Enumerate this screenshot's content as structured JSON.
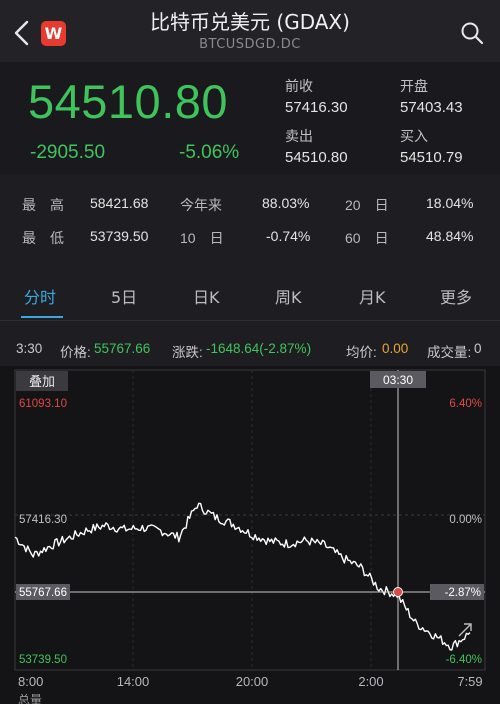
{
  "header": {
    "title": "比特币兑美元 (GDAX)",
    "subtitle": "BTCUSDGD.DC",
    "logo_text": "W"
  },
  "price": {
    "last": "54510.80",
    "change": "-2905.50",
    "change_pct": "-5.06%",
    "prev_close_label": "前收",
    "prev_close": "57416.30",
    "open_label": "开盘",
    "open": "57403.43",
    "bid_label": "卖出",
    "bid": "54510.80",
    "ask_label": "买入",
    "ask": "54510.79"
  },
  "stats": {
    "high_label": "最　高",
    "high": "58421.68",
    "low_label": "最　低",
    "low": "53739.50",
    "ytd_label": "今年来",
    "ytd": "88.03%",
    "d10_label": "10　日",
    "d10": "-0.74%",
    "d20_label": "20　日",
    "d20": "18.04%",
    "d60_label": "60　日",
    "d60": "48.84%"
  },
  "tabs": [
    "分时",
    "5日",
    "日K",
    "周K",
    "月K",
    "更多"
  ],
  "quote": {
    "time": "3:30",
    "price_label": "价格:",
    "price": "55767.66",
    "change_label": "涨跌:",
    "change": "-1648.64(-2.87%)",
    "avg_label": "均价:",
    "avg": "0.00",
    "volume_label": "成交量:",
    "volume": "0"
  },
  "chart": {
    "overlay_label": "叠加",
    "cursor_time": "03:30",
    "y_high": "61093.10",
    "y_mid": "57416.30",
    "y_low": "53739.50",
    "pct_high": "6.40%",
    "pct_mid": "0.00%",
    "pct_low": "-6.40%",
    "cursor_price": "55767.66",
    "cursor_pct": "-2.87%",
    "x_labels": [
      "8:00",
      "14:00",
      "20:00",
      "2:00",
      "7:59"
    ],
    "bottom_label": "总量",
    "colors": {
      "line": "#ffffff",
      "crosshair": "#c8c8c8",
      "up": "#e04848",
      "down": "#3fc35b",
      "marker": "#e04848"
    }
  },
  "chart_data": {
    "type": "line",
    "title": "",
    "xlabel": "",
    "ylabel": "",
    "ylim": [
      53739.5,
      61093.1
    ],
    "x": [
      "8:00",
      "9:00",
      "10:00",
      "11:00",
      "12:00",
      "13:00",
      "14:00",
      "15:00",
      "16:00",
      "17:00",
      "18:00",
      "19:00",
      "20:00",
      "21:00",
      "22:00",
      "23:00",
      "0:00",
      "1:00",
      "2:00",
      "3:00",
      "3:30",
      "4:00",
      "5:00",
      "6:00",
      "7:00",
      "7:59"
    ],
    "series": [
      {
        "values": [
          57216,
          56710,
          56980,
          57200,
          57420,
          57550,
          57430,
          57480,
          57400,
          57210,
          58130,
          57780,
          57580,
          57290,
          57100,
          57030,
          57120,
          56990,
          56620,
          56360,
          55770,
          55580,
          54790,
          54450,
          54120,
          54511
        ]
      }
    ]
  }
}
